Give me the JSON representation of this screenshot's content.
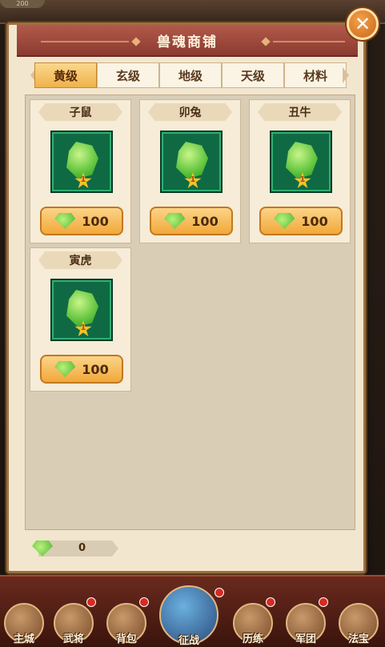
{
  "modal": {
    "title": "兽魂商铺",
    "close_icon": "close-icon"
  },
  "tabs": [
    {
      "label": "黄级",
      "active": true
    },
    {
      "label": "玄级",
      "active": false
    },
    {
      "label": "地级",
      "active": false
    },
    {
      "label": "天级",
      "active": false
    },
    {
      "label": "材料",
      "active": false
    }
  ],
  "items": [
    {
      "name": "子鼠",
      "star": "1",
      "price": "100",
      "icon": "green-gem-icon"
    },
    {
      "name": "卯兔",
      "star": "1",
      "price": "100",
      "icon": "green-gem-icon"
    },
    {
      "name": "丑牛",
      "star": "1",
      "price": "100",
      "icon": "green-gem-icon"
    },
    {
      "name": "寅虎",
      "star": "1",
      "price": "100",
      "icon": "green-gem-icon"
    }
  ],
  "currency": {
    "value": "0",
    "icon": "green-gem-icon"
  },
  "bottom_nav": [
    {
      "label": "主城"
    },
    {
      "label": "武将"
    },
    {
      "label": "背包"
    },
    {
      "label": "征战"
    },
    {
      "label": "历练"
    },
    {
      "label": "军团"
    },
    {
      "label": "法宝"
    }
  ],
  "top_badge": "200",
  "colors": {
    "header": "#8c3a30",
    "tab_active": "#f0b24a",
    "item_frame": "#0f6a44",
    "price_button": "#f2a83a"
  }
}
